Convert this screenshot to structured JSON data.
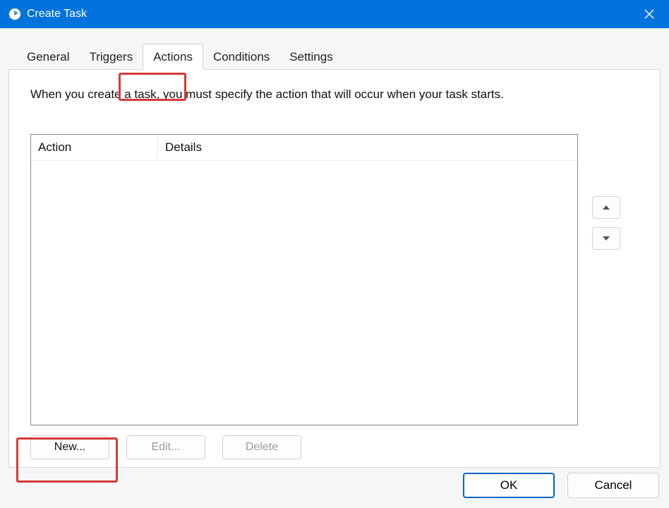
{
  "window": {
    "title": "Create Task"
  },
  "tabs": {
    "general": "General",
    "triggers": "Triggers",
    "actions": "Actions",
    "conditions": "Conditions",
    "settings": "Settings",
    "active": "actions"
  },
  "actions_page": {
    "instruction": "When you create a task, you must specify the action that will occur when your task starts.",
    "columns": {
      "action": "Action",
      "details": "Details"
    },
    "rows": [],
    "buttons": {
      "new": "New...",
      "edit": "Edit...",
      "delete": "Delete"
    }
  },
  "dialog": {
    "ok": "OK",
    "cancel": "Cancel"
  }
}
